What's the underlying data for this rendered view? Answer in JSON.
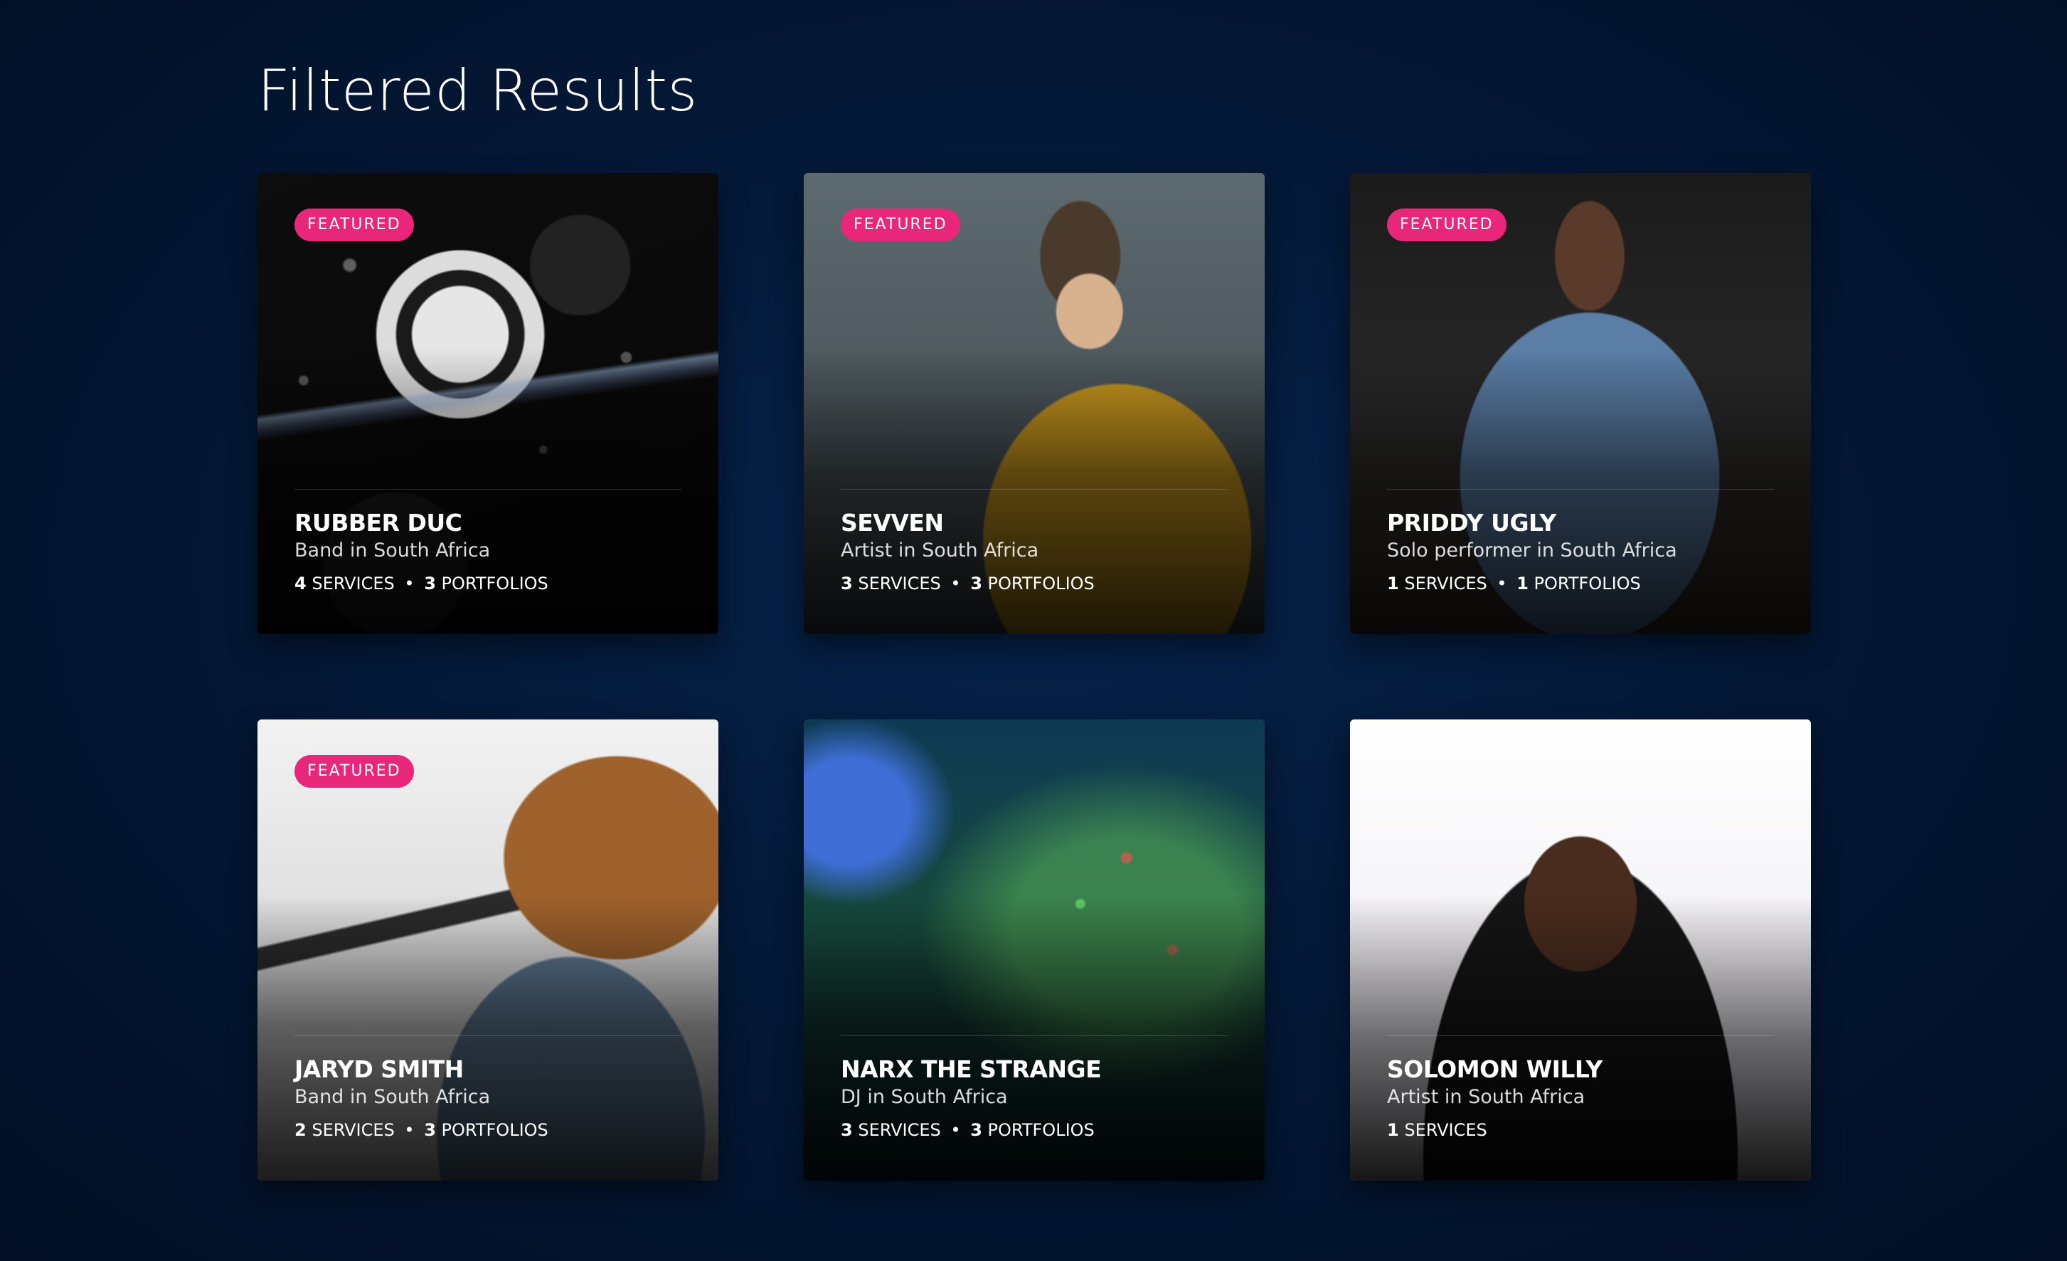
{
  "page": {
    "title": "Filtered Results"
  },
  "cards": [
    {
      "name": "RUBBER DUC",
      "subtitle": "Band in South Africa",
      "badge": "FEATURED",
      "services_count": "4",
      "services_label": "SERVICES",
      "portfolios_count": "3",
      "portfolios_label": "PORTFOLIOS",
      "image": "band-splash-photo"
    },
    {
      "name": "SEVVEN",
      "subtitle": "Artist in South Africa",
      "badge": "FEATURED",
      "services_count": "3",
      "services_label": "SERVICES",
      "portfolios_count": "3",
      "portfolios_label": "PORTFOLIOS",
      "image": "artist-yellow-jacket-photo"
    },
    {
      "name": "PRIDDY UGLY",
      "subtitle": "Solo performer in South Africa",
      "badge": "FEATURED",
      "services_count": "1",
      "services_label": "SERVICES",
      "portfolios_count": "1",
      "portfolios_label": "PORTFOLIOS",
      "image": "performer-denim-jacket-photo"
    },
    {
      "name": "JARYD SMITH",
      "subtitle": "Band in South Africa",
      "badge": "FEATURED",
      "services_count": "2",
      "services_label": "SERVICES",
      "portfolios_count": "3",
      "portfolios_label": "PORTFOLIOS",
      "image": "guitarist-photo"
    },
    {
      "name": "NARX THE STRANGE",
      "subtitle": "DJ in South Africa",
      "services_count": "3",
      "services_label": "SERVICES",
      "portfolios_count": "3",
      "portfolios_label": "PORTFOLIOS",
      "image": "dj-studio-photo"
    },
    {
      "name": "SOLOMON WILLY",
      "subtitle": "Artist in South Africa",
      "services_count": "1",
      "services_label": "SERVICES",
      "image": "artist-portrait-photo"
    }
  ],
  "colors": {
    "background": "#041a3a",
    "badge": "#e8267a",
    "text": "#ffffff"
  },
  "separator": "•"
}
